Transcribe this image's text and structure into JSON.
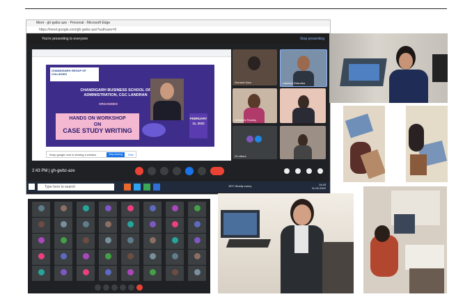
{
  "meet_window": {
    "title": "Meet - gh-gwbz-aze - Personal - Microsoft Edge",
    "url": "https://meet.google.com/gh-gwbz-aze?authuser=0",
    "presenting_text": "You're presenting to everyone",
    "stop_presenting": "Stop presenting",
    "slide": {
      "college_logo": "CHANDIGARH GROUP OF COLLEGES",
      "institute": "CHANDIGARH BUSINESS SCHOOL OF ADMINISTRATION, CGC LANDRAN",
      "organises": "ORGANISES",
      "banner_line1": "HANDS ON WORKSHOP",
      "banner_line2": "ON",
      "banner_line3": "CASE STUDY WRITING",
      "date": "FEBRUARY 11, 2022"
    },
    "notice_text": "Keep google.com is sharing a window",
    "notice_stop": "Stop sharing",
    "notice_hide": "Hide",
    "participant_tiles": [
      {
        "name": "Gurneet Kaur"
      },
      {
        "name": "Lakshmi Dhandha"
      },
      {
        "name": "Abhishek Pandey"
      },
      {
        "name": ""
      },
      {
        "name": "24 others"
      },
      {
        "name": ""
      }
    ],
    "bottom_time": "2:43 PM",
    "meeting_code": "gh-gwbz-aze",
    "taskbar_search": "Type here to search",
    "weather": "18°C Mostly sunny",
    "clock_time": "14:43",
    "clock_date": "11-02-2022"
  },
  "colors": {
    "meet_bg": "#202124",
    "slide_purple": "#3f2d8c",
    "banner_pink": "#f4b8d2",
    "hangup_red": "#ea4335"
  },
  "icons": [
    "mic-icon",
    "camera-icon",
    "present-icon",
    "hangup-icon",
    "search-icon",
    "windows-icon"
  ]
}
